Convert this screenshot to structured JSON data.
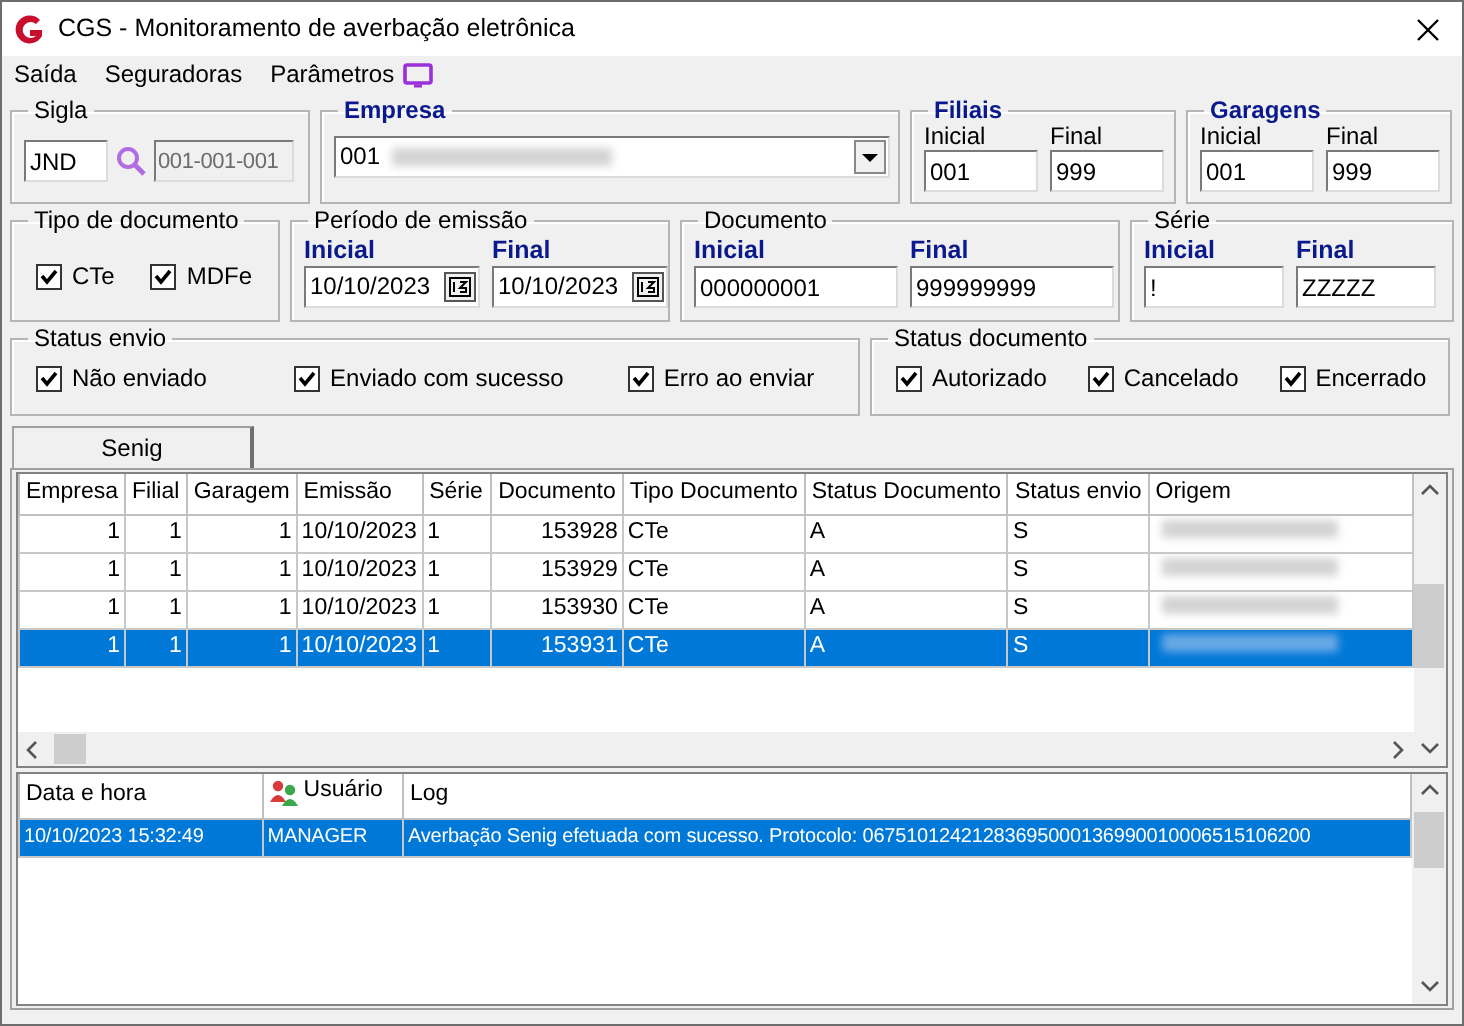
{
  "window": {
    "title": "CGS - Monitoramento de averbação eletrônica"
  },
  "menu": [
    "Saída",
    "Seguradoras",
    "Parâmetros"
  ],
  "sigla": {
    "title": "Sigla",
    "value": "JND",
    "code": "001-001-001"
  },
  "empresa": {
    "title": "Empresa",
    "value": "001"
  },
  "filiais": {
    "title": "Filiais",
    "fields": [
      {
        "label": "Inicial",
        "value": "001"
      },
      {
        "label": "Final",
        "value": "999"
      }
    ]
  },
  "garagens": {
    "title": "Garagens",
    "fields": [
      {
        "label": "Inicial",
        "value": "001"
      },
      {
        "label": "Final",
        "value": "999"
      }
    ]
  },
  "tipo_documento": {
    "title": "Tipo de documento",
    "options": [
      {
        "label": "CTe",
        "checked": true
      },
      {
        "label": "MDFe",
        "checked": true
      }
    ]
  },
  "periodo_emissao": {
    "title": "Período de emissão",
    "fields": [
      {
        "label": "Inicial",
        "value": "10/10/2023"
      },
      {
        "label": "Final",
        "value": "10/10/2023"
      }
    ]
  },
  "documento": {
    "title": "Documento",
    "fields": [
      {
        "label": "Inicial",
        "value": "000000001"
      },
      {
        "label": "Final",
        "value": "999999999"
      }
    ]
  },
  "serie": {
    "title": "Série",
    "fields": [
      {
        "label": "Inicial",
        "value": "!"
      },
      {
        "label": "Final",
        "value": "ZZZZZ"
      }
    ]
  },
  "status_envio": {
    "title": "Status envio",
    "options": [
      {
        "label": "Não enviado",
        "checked": true
      },
      {
        "label": "Enviado com sucesso",
        "checked": true
      },
      {
        "label": "Erro ao enviar",
        "checked": true
      }
    ]
  },
  "status_documento": {
    "title": "Status documento",
    "options": [
      {
        "label": "Autorizado",
        "checked": true
      },
      {
        "label": "Cancelado",
        "checked": true
      },
      {
        "label": "Encerrado",
        "checked": true
      }
    ]
  },
  "tabs": [
    {
      "label": "Senig",
      "selected": true
    }
  ],
  "grid": {
    "columns": [
      "Empresa",
      "Filial",
      "Garagem",
      "Emissão",
      "Série",
      "Documento",
      "Tipo Documento",
      "Status Documento",
      "Status envio",
      "Origem"
    ],
    "rows": [
      {
        "cells": [
          "1",
          "1",
          "1",
          "10/10/2023",
          "1",
          "153928",
          "CTe",
          "A",
          "S"
        ],
        "selected": false
      },
      {
        "cells": [
          "1",
          "1",
          "1",
          "10/10/2023",
          "1",
          "153929",
          "CTe",
          "A",
          "S"
        ],
        "selected": false
      },
      {
        "cells": [
          "1",
          "1",
          "1",
          "10/10/2023",
          "1",
          "153930",
          "CTe",
          "A",
          "S"
        ],
        "selected": false
      },
      {
        "cells": [
          "1",
          "1",
          "1",
          "10/10/2023",
          "1",
          "153931",
          "CTe",
          "A",
          "S"
        ],
        "selected": true
      }
    ]
  },
  "log": {
    "columns": [
      "Data e hora",
      "Usuário",
      "Log"
    ],
    "rows": [
      {
        "cells": [
          "10/10/2023 15:32:49",
          "MANAGER",
          "Averbação Senig efetuada com sucesso. Protocolo: 06751012421283695000136990010006515106200"
        ],
        "selected": true
      }
    ]
  }
}
